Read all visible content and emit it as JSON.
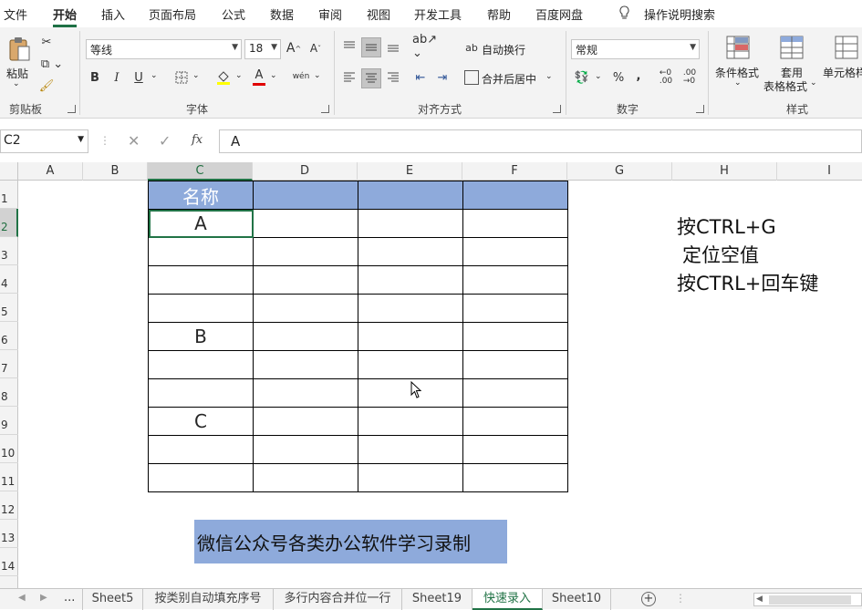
{
  "menu": {
    "items": [
      "文件",
      "开始",
      "插入",
      "页面布局",
      "公式",
      "数据",
      "审阅",
      "视图",
      "开发工具",
      "帮助",
      "百度网盘"
    ],
    "active": "开始",
    "search_label": "操作说明搜索"
  },
  "ribbon": {
    "clipboard": {
      "paste_label": "粘贴",
      "group_label": "剪贴板"
    },
    "font": {
      "font_name": "等线",
      "font_size": "18",
      "group_label": "字体",
      "bold": "B",
      "italic": "I",
      "underline": "U",
      "font_color_glyph": "A",
      "phonetic_glyph": "wén"
    },
    "alignment": {
      "wrap_text_label": "自动换行",
      "merge_center_label": "合并后居中",
      "group_label": "对齐方式"
    },
    "number": {
      "format": "常规",
      "percent": "%",
      "comma": ",",
      "group_label": "数字"
    },
    "styles": {
      "conditional_label": "条件格式",
      "table_format_label_1": "套用",
      "table_format_label_2": "表格格式",
      "cell_styles_label": "单元格样",
      "group_label": "样式"
    }
  },
  "formula_bar": {
    "name_box": "C2",
    "fx_symbol": "fx",
    "value": "A"
  },
  "columns": [
    "A",
    "B",
    "C",
    "D",
    "E",
    "F",
    "G",
    "H",
    "I"
  ],
  "selected_column": "C",
  "rows": [
    "1",
    "2",
    "3",
    "4",
    "5",
    "6",
    "7",
    "8",
    "9",
    "10",
    "11",
    "12",
    "13",
    "14"
  ],
  "selected_row": "2",
  "table": {
    "header": [
      "名称",
      "",
      "",
      ""
    ],
    "rows": [
      [
        "A",
        "",
        "",
        ""
      ],
      [
        "",
        "",
        "",
        ""
      ],
      [
        "",
        "",
        "",
        ""
      ],
      [
        "",
        "",
        "",
        ""
      ],
      [
        "B",
        "",
        "",
        ""
      ],
      [
        "",
        "",
        "",
        ""
      ],
      [
        "",
        "",
        "",
        ""
      ],
      [
        "C",
        "",
        "",
        ""
      ],
      [
        "",
        "",
        "",
        ""
      ],
      [
        "",
        "",
        "",
        ""
      ]
    ]
  },
  "notes": {
    "line1": "按CTRL+G",
    "line2": "定位空值",
    "line3": "按CTRL+回车键"
  },
  "promo_text": "微信公众号各类办公软件学习录制",
  "sheet_tabs": {
    "ellipsis": "...",
    "tabs": [
      "Sheet5",
      "按类别自动填充序号",
      "多行内容合并位一行",
      "Sheet19",
      "快速录入",
      "Sheet10"
    ],
    "active": "快速录入",
    "add_glyph": "+"
  },
  "colors": {
    "accent_green": "#217346",
    "header_fill": "#8eaadb"
  }
}
